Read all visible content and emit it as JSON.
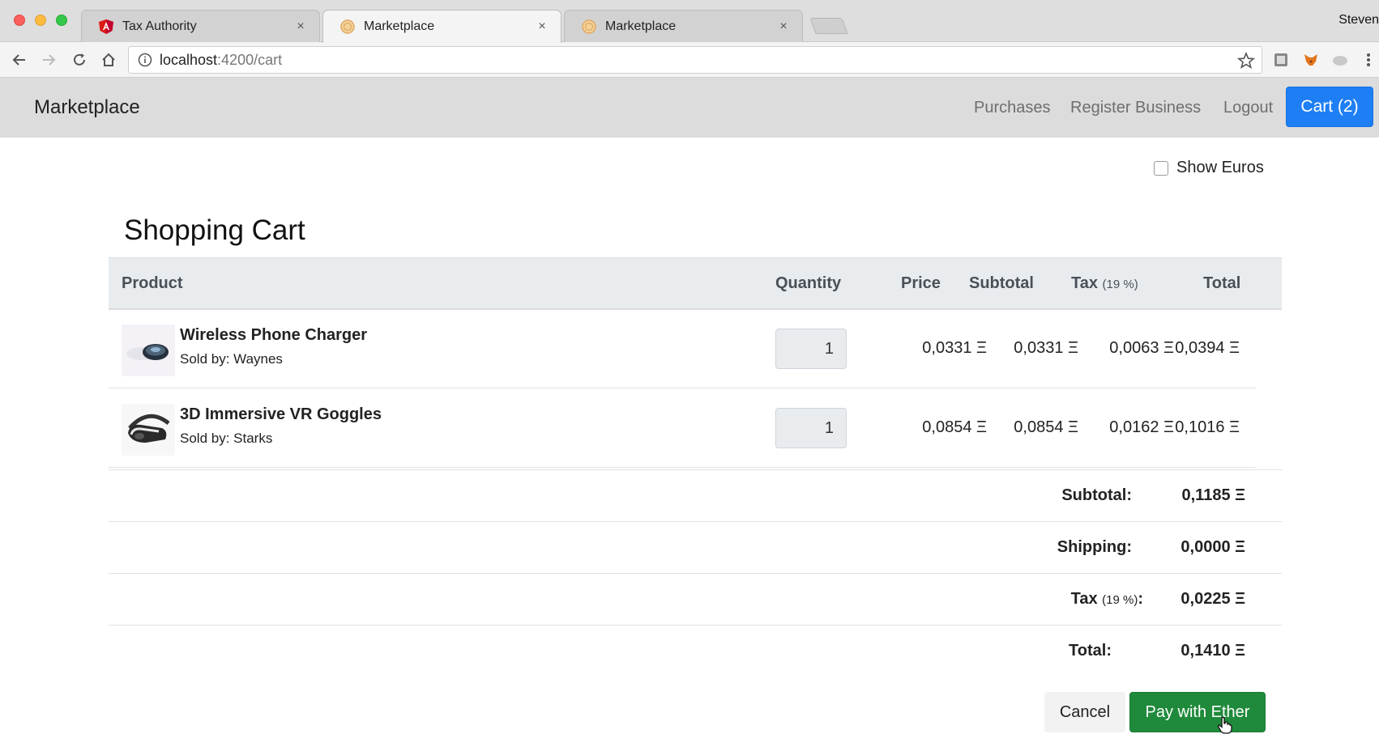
{
  "browser": {
    "tabs": [
      {
        "title": "Tax Authority",
        "close": "×"
      },
      {
        "title": "Marketplace",
        "close": "×"
      },
      {
        "title": "Marketplace",
        "close": "×"
      }
    ],
    "profile": "Steven",
    "url_host": "localhost",
    "url_rest": ":4200/cart"
  },
  "navbar": {
    "brand": "Marketplace",
    "links": [
      "Purchases",
      "Register Business",
      "Logout"
    ],
    "cart_label": "Cart (2)"
  },
  "show_euros_label": "Show Euros",
  "heading": "Shopping Cart",
  "table": {
    "headers": {
      "product": "Product",
      "quantity": "Quantity",
      "price": "Price",
      "subtotal": "Subtotal",
      "tax": "Tax",
      "tax_rate": "(19 %)",
      "total": "Total"
    },
    "rows": [
      {
        "name": "Wireless Phone Charger",
        "seller": "Sold by: Waynes",
        "quantity": "1",
        "price": "0,0331 Ξ",
        "subtotal": "0,0331 Ξ",
        "tax": "0,0063 Ξ",
        "total": "0,0394 Ξ"
      },
      {
        "name": "3D Immersive VR Goggles",
        "seller": "Sold by: Starks",
        "quantity": "1",
        "price": "0,0854 Ξ",
        "subtotal": "0,0854 Ξ",
        "tax": "0,0162 Ξ",
        "total": "0,1016 Ξ"
      }
    ]
  },
  "summary": {
    "subtotal_label": "Subtotal:",
    "subtotal_value": "0,1185 Ξ",
    "shipping_label": "Shipping:",
    "shipping_value": "0,0000 Ξ",
    "tax_label": "Tax",
    "tax_rate": "(19 %)",
    "tax_colon": ":",
    "tax_value": "0,0225 Ξ",
    "total_label": "Total:",
    "total_value": "0,1410 Ξ"
  },
  "actions": {
    "cancel": "Cancel",
    "pay": "Pay with Ether"
  },
  "colors": {
    "cart_button": "#1e7ff5",
    "pay_button": "#1f8a3b",
    "navbar_bg": "#dcdcdc"
  }
}
